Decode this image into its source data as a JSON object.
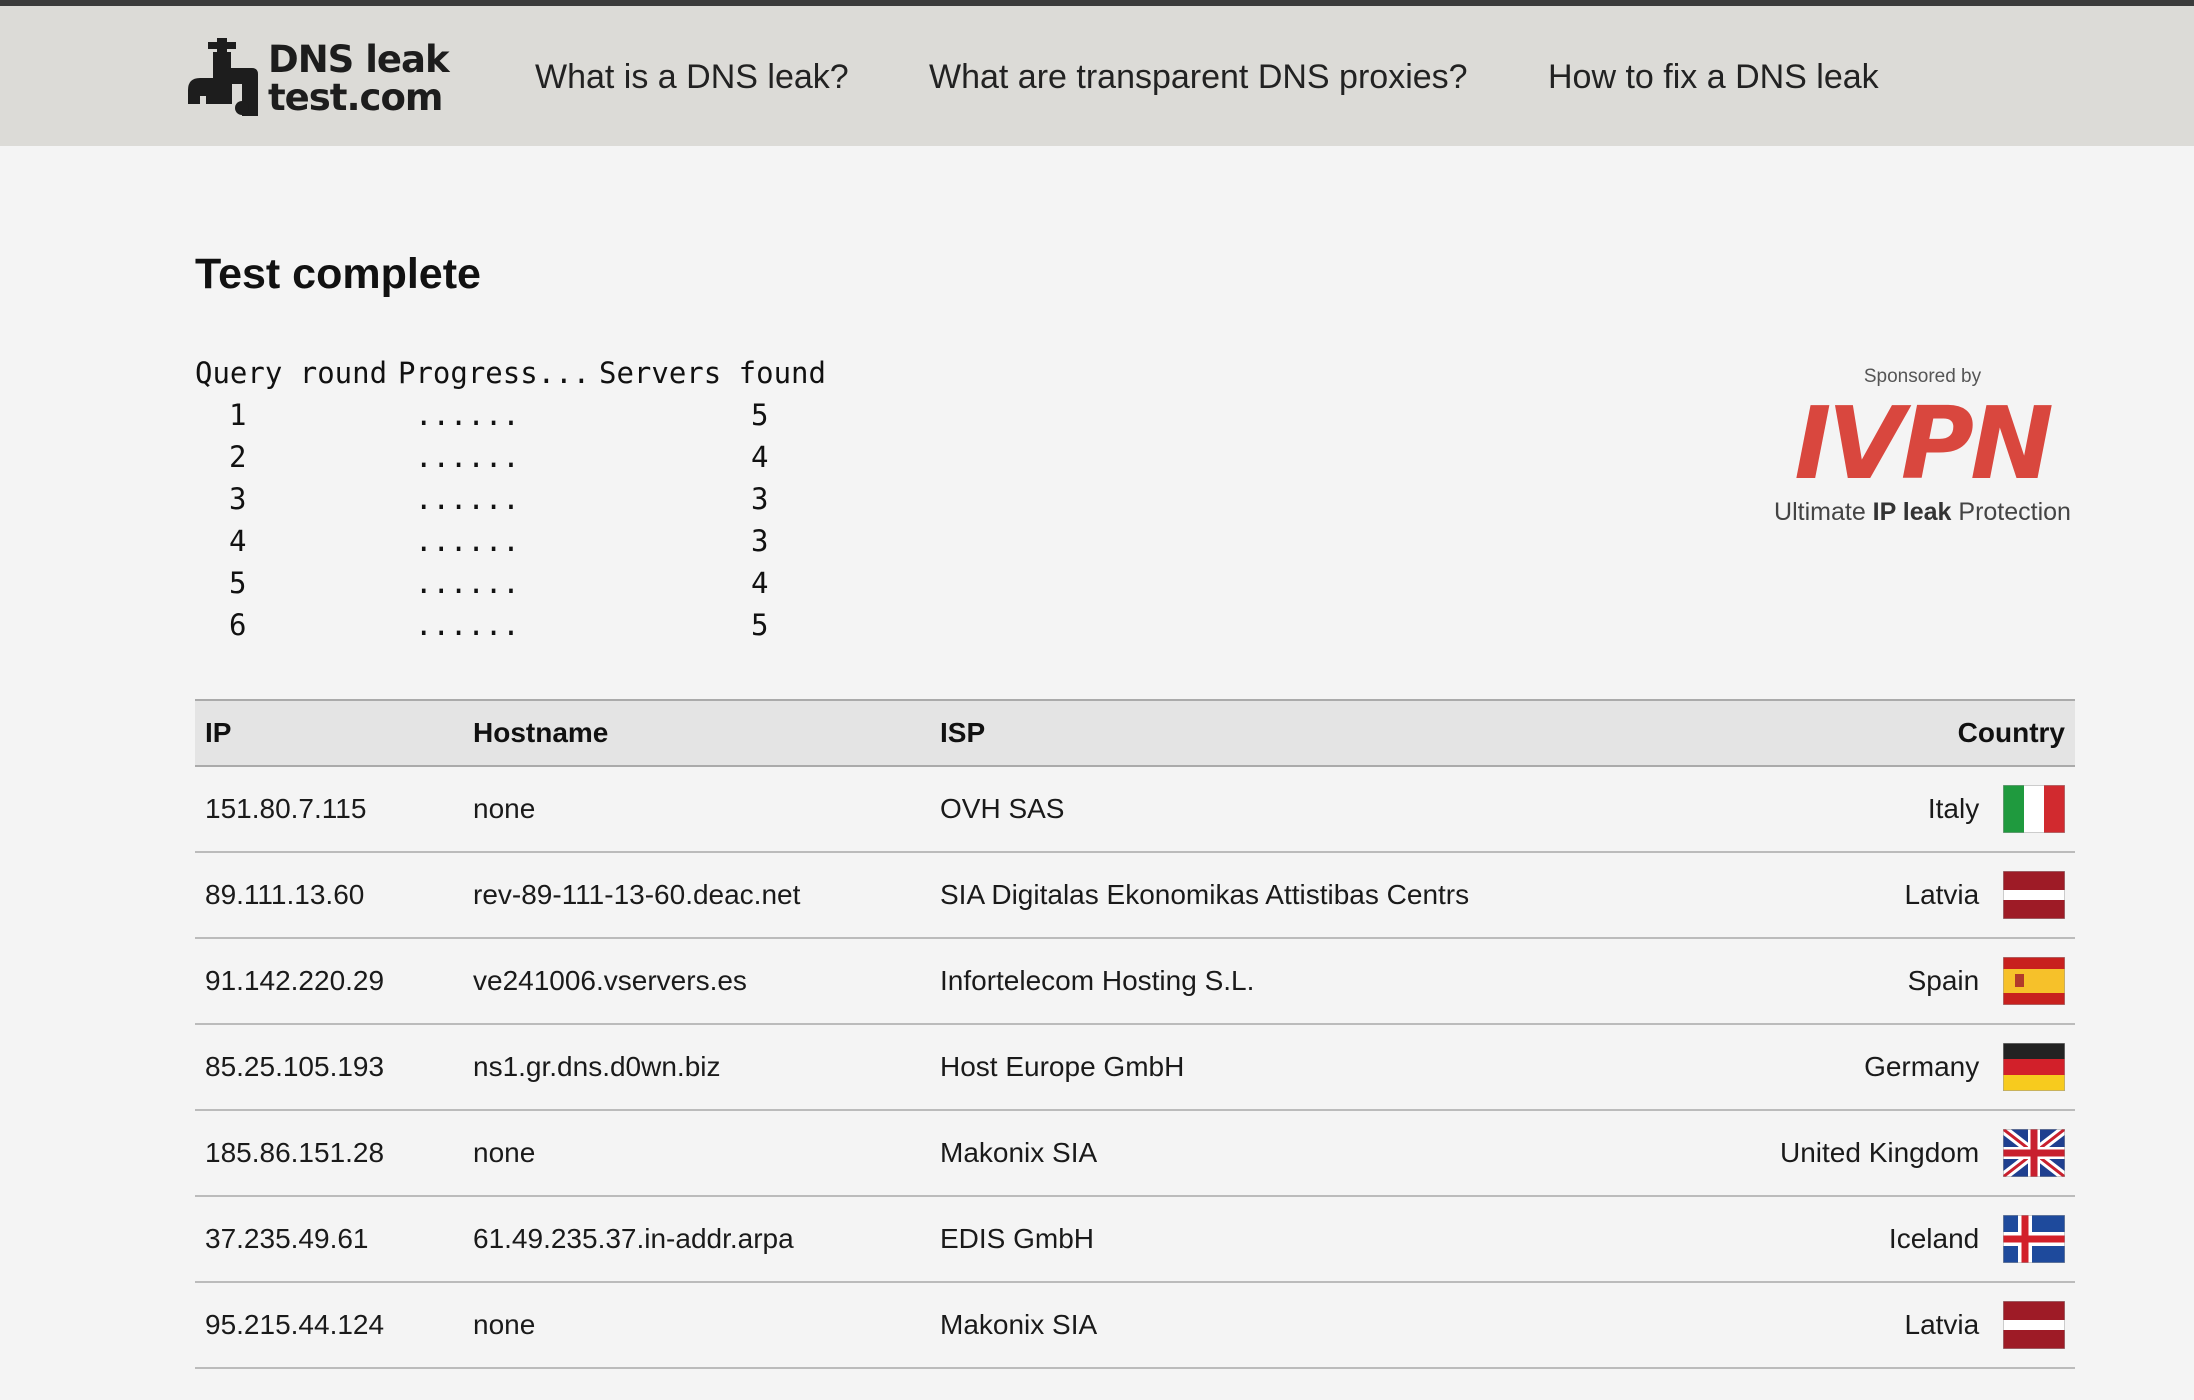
{
  "header": {
    "logo": {
      "line1": "DNS leak",
      "line2": "test.com"
    },
    "nav": [
      {
        "label": "What is a DNS leak?"
      },
      {
        "label": "What are transparent DNS proxies?"
      },
      {
        "label": "How to fix a DNS leak"
      }
    ]
  },
  "main": {
    "title": "Test complete",
    "progress": {
      "headers": [
        "Query round",
        "Progress...",
        "Servers found"
      ],
      "rows": [
        {
          "round": "1",
          "progress": "......",
          "servers": "5"
        },
        {
          "round": "2",
          "progress": "......",
          "servers": "4"
        },
        {
          "round": "3",
          "progress": "......",
          "servers": "3"
        },
        {
          "round": "4",
          "progress": "......",
          "servers": "3"
        },
        {
          "round": "5",
          "progress": "......",
          "servers": "4"
        },
        {
          "round": "6",
          "progress": "......",
          "servers": "5"
        }
      ]
    },
    "sponsor": {
      "label": "Sponsored by",
      "brand": "IVPN",
      "tagline_pre": "Ultimate ",
      "tagline_bold": "IP leak",
      "tagline_post": " Protection",
      "brand_color": "#d9473e"
    },
    "table": {
      "headers": {
        "ip": "IP",
        "hostname": "Hostname",
        "isp": "ISP",
        "country": "Country"
      },
      "rows": [
        {
          "ip": "151.80.7.115",
          "hostname": "none",
          "isp": "OVH SAS",
          "country": "Italy",
          "flag": "italy-flag-icon"
        },
        {
          "ip": "89.111.13.60",
          "hostname": "rev-89-111-13-60.deac.net",
          "isp": "SIA Digitalas Ekonomikas Attistibas Centrs",
          "country": "Latvia",
          "flag": "latvia-flag-icon"
        },
        {
          "ip": "91.142.220.29",
          "hostname": "ve241006.vservers.es",
          "isp": "Infortelecom Hosting S.L.",
          "country": "Spain",
          "flag": "spain-flag-icon"
        },
        {
          "ip": "85.25.105.193",
          "hostname": "ns1.gr.dns.d0wn.biz",
          "isp": "Host Europe GmbH",
          "country": "Germany",
          "flag": "germany-flag-icon"
        },
        {
          "ip": "185.86.151.28",
          "hostname": "none",
          "isp": "Makonix SIA",
          "country": "United Kingdom",
          "flag": "uk-flag-icon"
        },
        {
          "ip": "37.235.49.61",
          "hostname": "61.49.235.37.in-addr.arpa",
          "isp": "EDIS GmbH",
          "country": "Iceland",
          "flag": "iceland-flag-icon"
        },
        {
          "ip": "95.215.44.124",
          "hostname": "none",
          "isp": "Makonix SIA",
          "country": "Latvia",
          "flag": "latvia-flag-icon"
        }
      ]
    }
  }
}
